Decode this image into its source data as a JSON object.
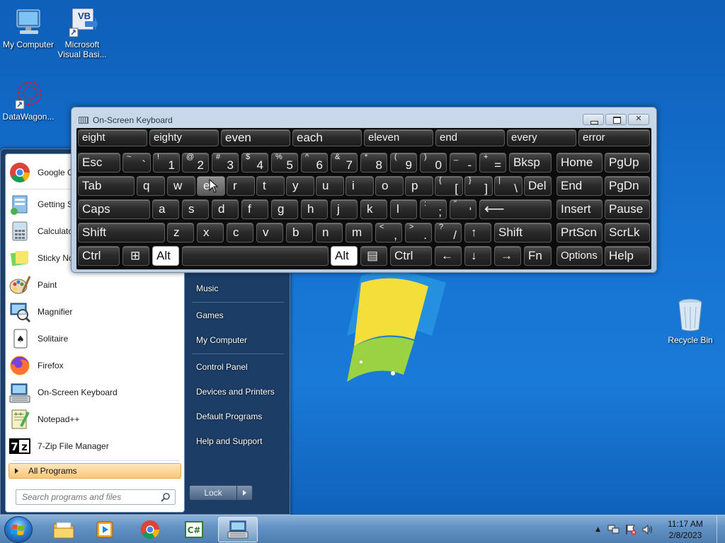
{
  "desktop": {
    "icons": [
      {
        "label1": "My Computer",
        "label2": ""
      },
      {
        "label1": "Microsoft",
        "label2": "Visual Basi..."
      },
      {
        "label1": "DataWagon...",
        "label2": ""
      }
    ],
    "recycle_bin": "Recycle Bin",
    "vb_badge": "VB"
  },
  "start_menu": {
    "programs": [
      {
        "label": "Google Chrome",
        "icon": "chrome-icon"
      },
      {
        "label": "Getting Started",
        "icon": "getting-started-icon"
      },
      {
        "label": "Calculator",
        "icon": "calculator-icon"
      },
      {
        "label": "Sticky Notes",
        "icon": "sticky-notes-icon"
      },
      {
        "label": "Paint",
        "icon": "paint-icon"
      },
      {
        "label": "Magnifier",
        "icon": "magnifier-icon"
      },
      {
        "label": "Solitaire",
        "icon": "solitaire-icon"
      },
      {
        "label": "Firefox",
        "icon": "firefox-icon"
      },
      {
        "label": "On-Screen Keyboard",
        "icon": "keyboard-icon"
      },
      {
        "label": "Notepad++",
        "icon": "notepadpp-icon"
      },
      {
        "label": "7-Zip File Manager",
        "icon": "7zip-icon"
      }
    ],
    "all_programs": "All Programs",
    "search_placeholder": "Search programs and files",
    "right_items": [
      "Music",
      "Games",
      "My Computer",
      "Control Panel",
      "Devices and Printers",
      "Default Programs",
      "Help and Support"
    ],
    "lock_label": "Lock"
  },
  "osk": {
    "title": "On-Screen Keyboard",
    "suggestions": [
      "eight",
      "eighty",
      "even",
      "each",
      "eleven",
      "end",
      "every",
      "error"
    ],
    "row1": {
      "esc": "Esc",
      "pairs": [
        [
          "~",
          "`"
        ],
        [
          "!",
          "1"
        ],
        [
          "@",
          "2"
        ],
        [
          "#",
          "3"
        ],
        [
          "$",
          "4"
        ],
        [
          "%",
          "5"
        ],
        [
          "^",
          "6"
        ],
        [
          "&",
          "7"
        ],
        [
          "*",
          "8"
        ],
        [
          "(",
          "9"
        ],
        [
          ")",
          "0"
        ],
        [
          "_",
          "-"
        ],
        [
          "+",
          "="
        ]
      ],
      "bksp": "Bksp",
      "home": "Home",
      "pgup": "PgUp"
    },
    "row2": {
      "tab": "Tab",
      "letters": [
        "q",
        "w",
        "e",
        "r",
        "t",
        "y",
        "u",
        "i",
        "o",
        "p"
      ],
      "pairs": [
        [
          "{",
          "["
        ],
        [
          "}",
          "]"
        ],
        [
          "|",
          "\\"
        ]
      ],
      "del": "Del",
      "end": "End",
      "pgdn": "PgDn"
    },
    "row3": {
      "caps": "Caps",
      "letters": [
        "a",
        "s",
        "d",
        "f",
        "g",
        "h",
        "j",
        "k",
        "l"
      ],
      "pairs": [
        [
          ":",
          ";"
        ],
        [
          "\"",
          "'"
        ]
      ],
      "enter_glyph": "⟵",
      "insert": "Insert",
      "pause": "Pause"
    },
    "row4": {
      "shift": "Shift",
      "letters": [
        "z",
        "x",
        "c",
        "v",
        "b",
        "n",
        "m"
      ],
      "pairs": [
        [
          "<",
          ","
        ],
        [
          ">",
          "."
        ],
        [
          "?",
          "/"
        ]
      ],
      "up": "↑",
      "shift_r": "Shift",
      "prtscn": "PrtScn",
      "scrlk": "ScrLk"
    },
    "row5": {
      "ctrl": "Ctrl",
      "win": "⊞",
      "alt": "Alt",
      "alt_r": "Alt",
      "menu": "▤",
      "ctrl_r": "Ctrl",
      "left": "←",
      "down": "↓",
      "right": "→",
      "fn": "Fn",
      "options": "Options",
      "help": "Help"
    }
  },
  "taskbar": {
    "time": "11:17 AM",
    "date": "2/8/2023",
    "tray_arrow": "▲"
  },
  "colors": {
    "accent": "#1571cf",
    "allprog_highlight": "#fbc77a"
  }
}
